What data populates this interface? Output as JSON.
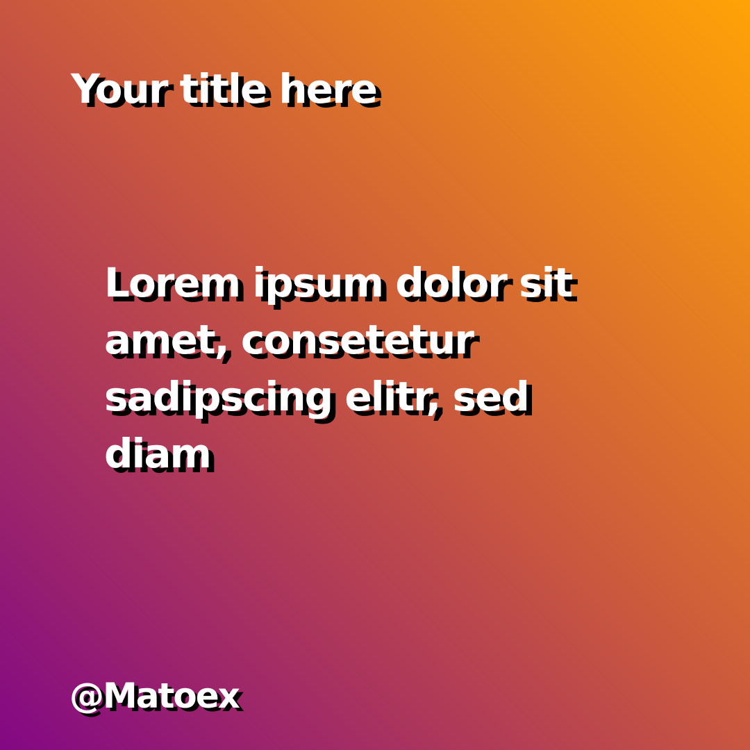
{
  "background": {
    "gradient_start": "#ffa306",
    "gradient_mid": "#c85640",
    "gradient_end": "#820884"
  },
  "text_color": "#ffffff",
  "shadow_color": "#000000",
  "title": "Your title here",
  "body_lines": [
    "Lorem ipsum dolor sit",
    "amet, consetetur",
    "sadipscing elitr, sed",
    "diam"
  ],
  "handle": "@Matoex"
}
